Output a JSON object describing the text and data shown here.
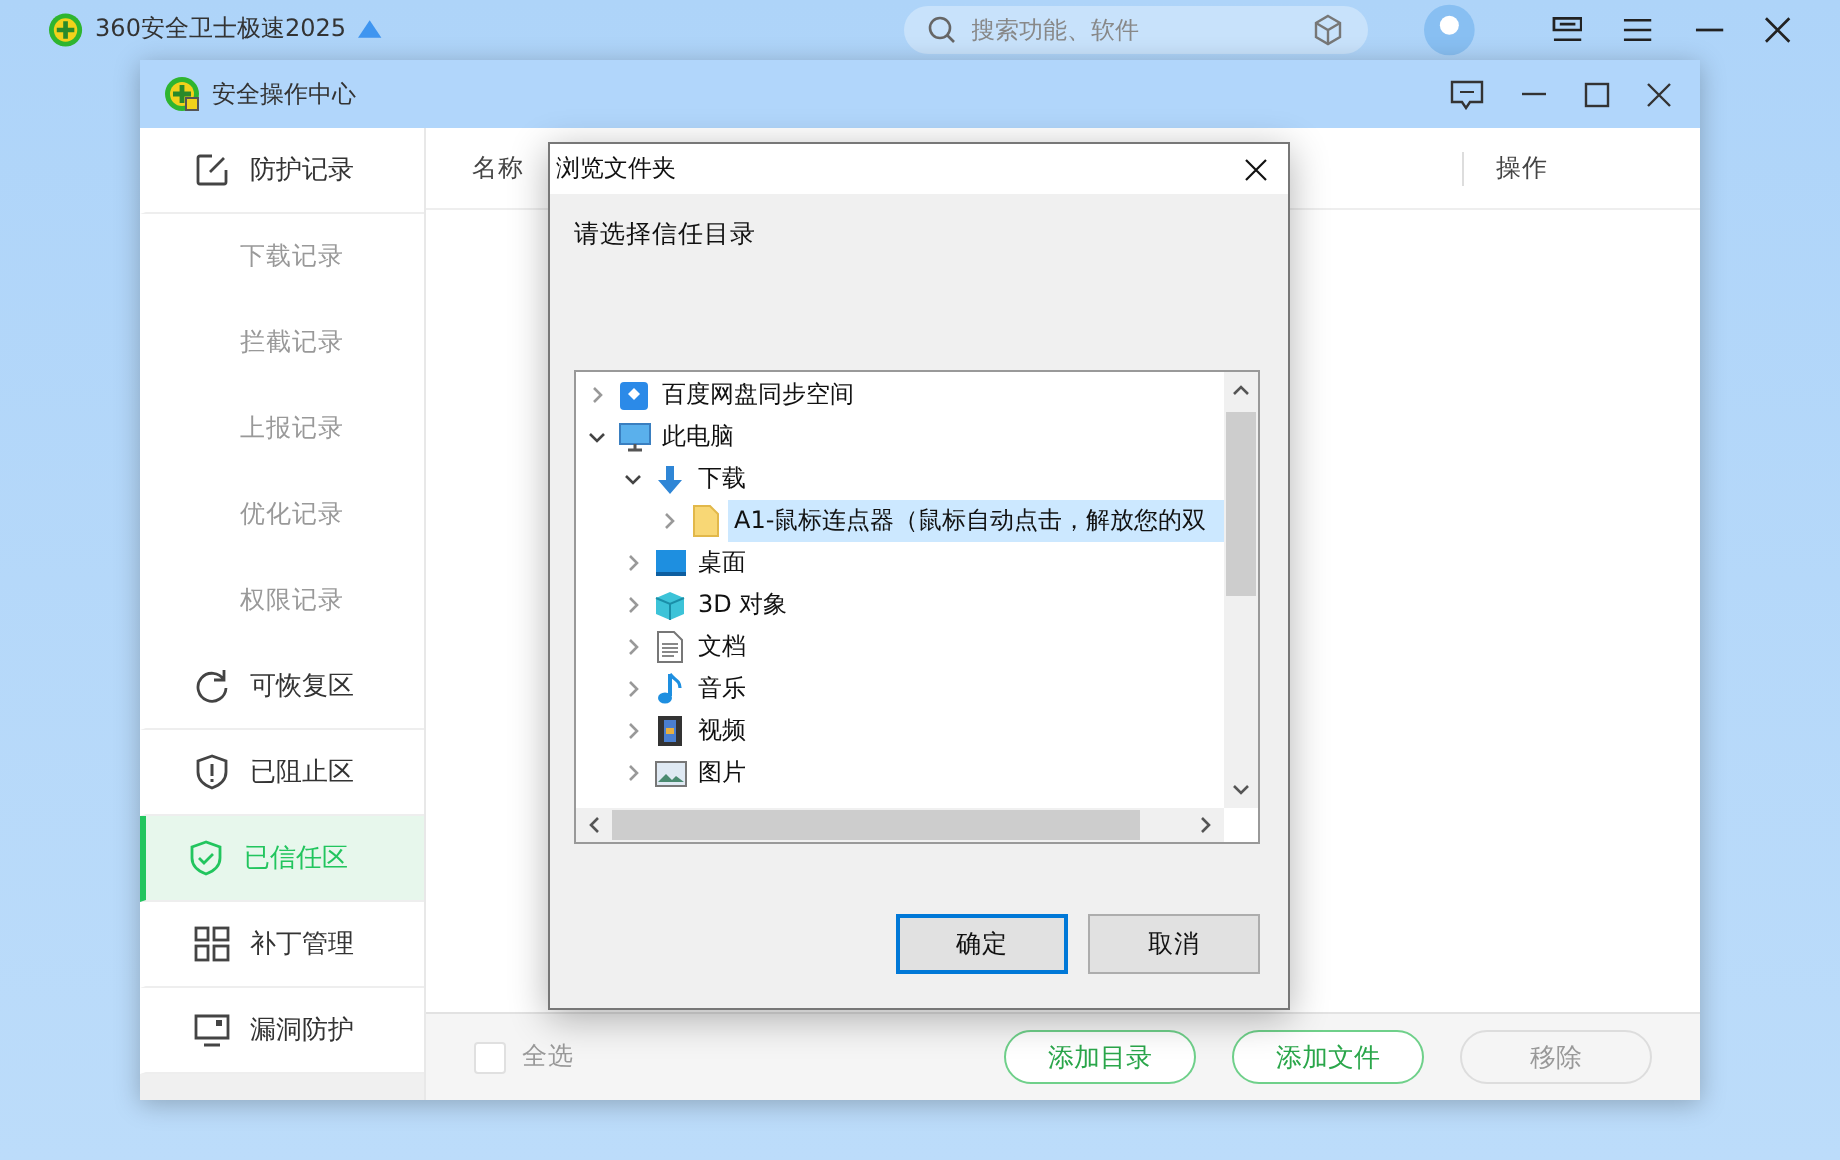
{
  "app": {
    "title": "360安全卫士极速2025",
    "search": {
      "placeholder": "搜索功能、软件"
    }
  },
  "window": {
    "title": "安全操作中心"
  },
  "sidebar": {
    "items": [
      {
        "label": "防护记录",
        "kind": "edit",
        "selected": false,
        "children": [
          {
            "label": "下载记录",
            "selected": false
          },
          {
            "label": "拦截记录",
            "selected": false
          },
          {
            "label": "上报记录",
            "selected": false
          },
          {
            "label": "优化记录",
            "selected": false
          },
          {
            "label": "权限记录",
            "selected": false
          }
        ]
      },
      {
        "label": "可恢复区",
        "kind": "restore",
        "selected": false
      },
      {
        "label": "已阻止区",
        "kind": "blocked",
        "selected": false
      },
      {
        "label": "已信任区",
        "kind": "trusted",
        "selected": true
      },
      {
        "label": "补丁管理",
        "kind": "patch",
        "selected": false
      },
      {
        "label": "漏洞防护",
        "kind": "vuln",
        "selected": false
      }
    ]
  },
  "table": {
    "columns": [
      "名称",
      "操作"
    ]
  },
  "footer": {
    "select_all": {
      "label": "全选",
      "checked": false
    },
    "buttons": [
      {
        "label": "添加目录",
        "disabled": false
      },
      {
        "label": "添加文件",
        "disabled": false
      },
      {
        "label": "移除",
        "disabled": true
      }
    ]
  },
  "dialog": {
    "title": "浏览文件夹",
    "prompt": "请选择信任目录",
    "tree": [
      {
        "label": "百度网盘同步空间",
        "kind": "cloud",
        "expanded": false,
        "selected": false
      },
      {
        "label": "此电脑",
        "kind": "pc",
        "expanded": true,
        "selected": false,
        "children": [
          {
            "label": "下载",
            "kind": "download",
            "expanded": true,
            "selected": false,
            "children": [
              {
                "label": "A1-鼠标连点器（鼠标自动点击，解放您的双",
                "kind": "folder",
                "expanded": false,
                "selected": true
              }
            ]
          },
          {
            "label": "桌面",
            "kind": "desktop",
            "expanded": false,
            "selected": false
          },
          {
            "label": "3D 对象",
            "kind": "cube",
            "expanded": false,
            "selected": false
          },
          {
            "label": "文档",
            "kind": "document",
            "expanded": false,
            "selected": false
          },
          {
            "label": "音乐",
            "kind": "music",
            "expanded": false,
            "selected": false
          },
          {
            "label": "视频",
            "kind": "video",
            "expanded": false,
            "selected": false
          },
          {
            "label": "图片",
            "kind": "picture",
            "expanded": false,
            "selected": false
          }
        ]
      }
    ],
    "buttons": [
      {
        "label": "确定",
        "default": true
      },
      {
        "label": "取消",
        "default": false
      }
    ]
  }
}
